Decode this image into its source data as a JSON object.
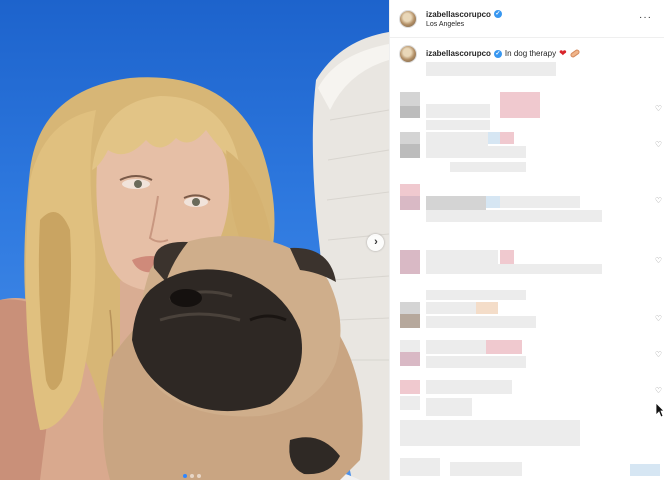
{
  "post": {
    "username": "izabellascorupco",
    "location": "Los Angeles",
    "caption_user": "izabellascorupco",
    "caption_text": "In dog therapy",
    "caption_emojis": [
      "red-heart",
      "adhesive-bandage"
    ]
  },
  "icons": {
    "verified": "✓",
    "more": "···",
    "next": "›",
    "like": "♡"
  },
  "carousel": {
    "slides": 3,
    "active": 1
  },
  "colors": {
    "accent": "#3897f0",
    "heart": "#d8232a",
    "sky": "#2f7ae0"
  }
}
